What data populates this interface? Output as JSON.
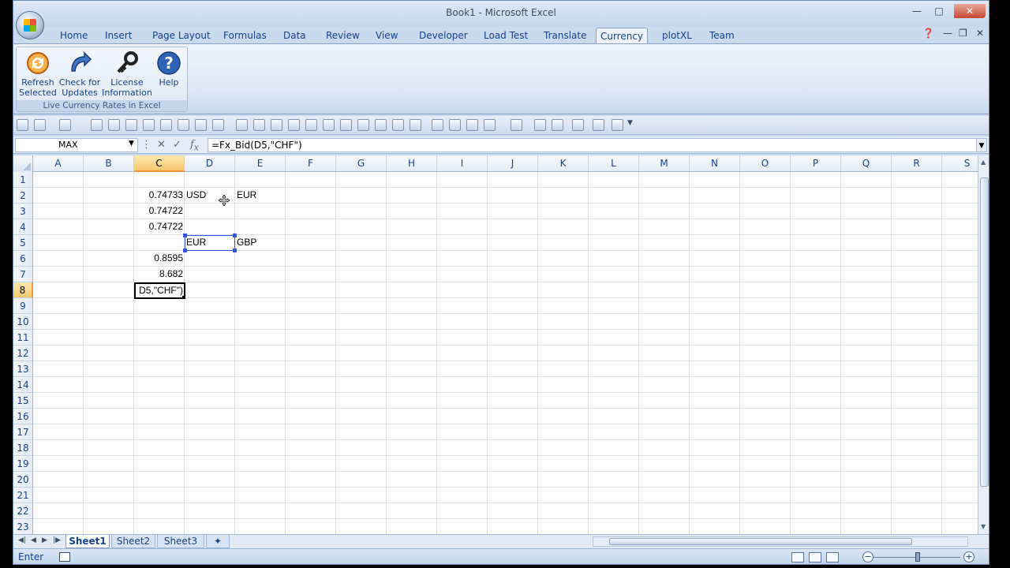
{
  "window": {
    "title": "Book1 - Microsoft Excel"
  },
  "tabs": [
    "Home",
    "Insert",
    "Page Layout",
    "Formulas",
    "Data",
    "Review",
    "View",
    "Developer",
    "Load Test",
    "Translate",
    "Currency",
    "plotXL",
    "Team"
  ],
  "active_tab": "Currency",
  "ribbon": {
    "buttons": [
      {
        "label1": "Refresh",
        "label2": "Selected",
        "icon": "refresh-icon"
      },
      {
        "label1": "Check for",
        "label2": "Updates",
        "icon": "update-arrow-icon"
      },
      {
        "label1": "License",
        "label2": "Information",
        "icon": "key-icon"
      },
      {
        "label1": "Help",
        "label2": "",
        "icon": "help-icon"
      }
    ],
    "group_label": "Live Currency Rates in Excel"
  },
  "formula_bar": {
    "name_box": "MAX",
    "formula": "=Fx_Bid(D5,\"CHF\")"
  },
  "columns": [
    "A",
    "B",
    "C",
    "D",
    "E",
    "F",
    "G",
    "H",
    "I",
    "J",
    "K",
    "L",
    "M",
    "N",
    "O",
    "P",
    "Q",
    "R",
    "S"
  ],
  "selected_column": "C",
  "rows": [
    "1",
    "2",
    "3",
    "4",
    "5",
    "6",
    "7",
    "8",
    "9",
    "10",
    "11",
    "12",
    "13",
    "14",
    "15",
    "16",
    "17",
    "18",
    "19",
    "20",
    "21",
    "22",
    "23"
  ],
  "selected_row": "8",
  "cells": {
    "C2": "0.74733",
    "D2": "USD",
    "E2": "EUR",
    "C3": "0.74722",
    "C4": "0.74722",
    "D5": "EUR",
    "E5": "GBP",
    "C6": "0.8595",
    "C7": "8.682",
    "C8": "D5,\"CHF\")"
  },
  "sheets": [
    "Sheet1",
    "Sheet2",
    "Sheet3"
  ],
  "active_sheet": "Sheet1",
  "status": {
    "mode": "Enter"
  },
  "colors": {
    "selection_header": "#f5c76d",
    "reference_border": "#3355dd"
  }
}
